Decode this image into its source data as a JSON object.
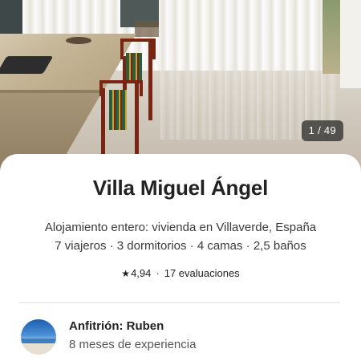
{
  "gallery": {
    "counter": "1 / 49"
  },
  "listing": {
    "title": "Villa Miguel Ángel",
    "type_location": "Alojamiento entero: vivienda en Villaverde, España",
    "capacity": "7 viajeros · 3 dormitorios · 4 camas · 2,5 baños",
    "rating_icon": "star-icon",
    "rating_star": "★",
    "rating_value": "4,94",
    "rating_sep": "·",
    "reviews": "17 evaluaciones"
  },
  "host": {
    "title": "Anfitrión: Ruben",
    "experience": "8 meses de experiencia"
  }
}
